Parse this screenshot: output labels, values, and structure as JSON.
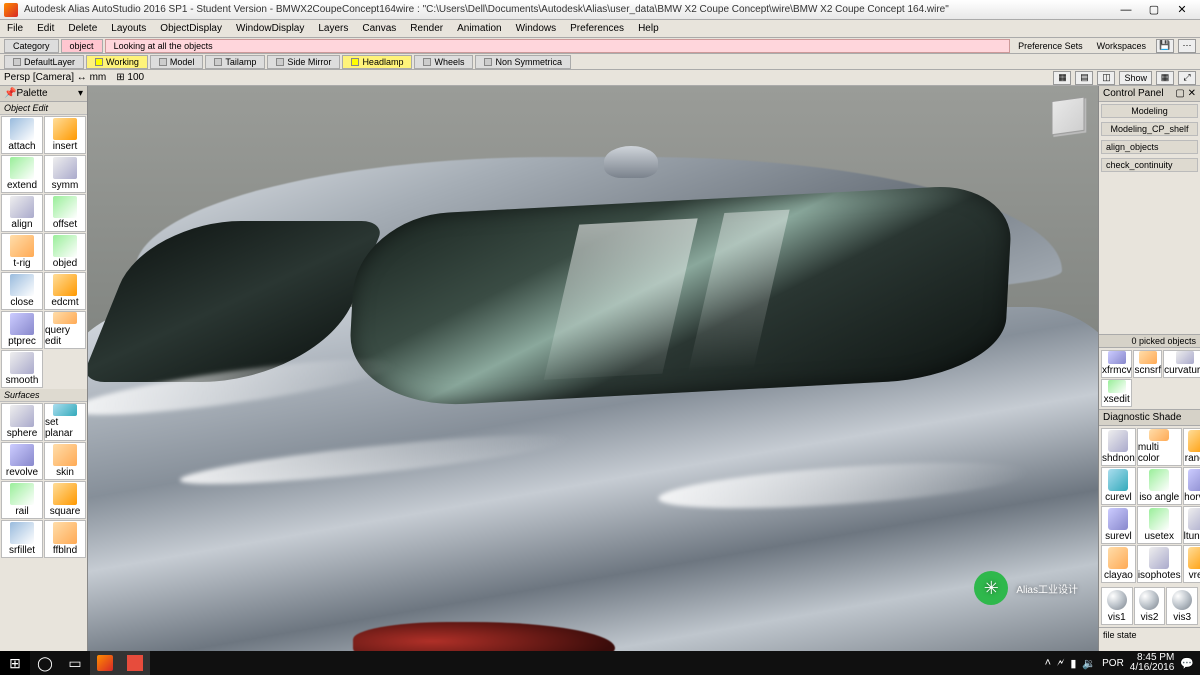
{
  "title": "Autodesk Alias AutoStudio 2016 SP1 - Student Version   - BMWX2CoupeConcept164wire : \"C:\\Users\\Dell\\Documents\\Autodesk\\Alias\\user_data\\BMW X2 Coupe Concept\\wire\\BMW X2 Coupe Concept 164.wire\"",
  "menu": [
    "File",
    "Edit",
    "Delete",
    "Layouts",
    "ObjectDisplay",
    "WindowDisplay",
    "Layers",
    "Canvas",
    "Render",
    "Animation",
    "Windows",
    "Preferences",
    "Help"
  ],
  "shelf1": {
    "category": "Category",
    "object": "object",
    "message": "Looking at all the objects",
    "prefsets": "Preference Sets",
    "workspaces": "Workspaces"
  },
  "shelf2": {
    "items": [
      {
        "label": "DefaultLayer",
        "cls": ""
      },
      {
        "label": "Working",
        "cls": "yellow"
      },
      {
        "label": "Model",
        "cls": ""
      },
      {
        "label": "Tailamp",
        "cls": ""
      },
      {
        "label": "Side Mirror",
        "cls": ""
      },
      {
        "label": "Headlamp",
        "cls": "yellow"
      },
      {
        "label": "Wheels",
        "cls": ""
      },
      {
        "label": "Non Symmetrica",
        "cls": ""
      }
    ]
  },
  "prompt": {
    "cam": "Persp [Camera]  ↔ mm",
    "tol": "⊞ 100",
    "show": "Show"
  },
  "palette": {
    "title": "Palette",
    "sec1": "Object Edit",
    "tools1": [
      {
        "l": "attach",
        "g": "g1"
      },
      {
        "l": "insert",
        "g": "g2"
      },
      {
        "l": "extend",
        "g": "g3"
      },
      {
        "l": "symm",
        "g": "g4"
      },
      {
        "l": "align",
        "g": "g4"
      },
      {
        "l": "offset",
        "g": "g3"
      },
      {
        "l": "t-rig",
        "g": "g6"
      },
      {
        "l": "objed",
        "g": "g3"
      },
      {
        "l": "close",
        "g": "g1"
      },
      {
        "l": "edcmt",
        "g": "g2"
      },
      {
        "l": "ptprec",
        "g": "g5"
      },
      {
        "l": "query edit",
        "g": "g6"
      },
      {
        "l": "smooth",
        "g": "g4"
      },
      {
        "l": "",
        "g": ""
      }
    ],
    "sec2": "Surfaces",
    "tools2": [
      {
        "l": "sphere",
        "g": "g4"
      },
      {
        "l": "set planar",
        "g": "g7"
      },
      {
        "l": "revolve",
        "g": "g5"
      },
      {
        "l": "skin",
        "g": "g6"
      },
      {
        "l": "rail",
        "g": "g3"
      },
      {
        "l": "square",
        "g": "g2"
      },
      {
        "l": "srfillet",
        "g": "g1"
      },
      {
        "l": "ffblnd",
        "g": "g6"
      }
    ]
  },
  "right": {
    "control_panel": "Control Panel",
    "modeling": "Modeling",
    "modeling_shelf": "Modeling_CP_shelf",
    "btn1": "align_objects",
    "btn2": "check_continuity",
    "picked": "0 picked objects",
    "picked_tools": [
      {
        "l": "xfrmcv",
        "g": "g5"
      },
      {
        "l": "scnsrf",
        "g": "g6"
      },
      {
        "l": "curvature",
        "g": "g4"
      },
      {
        "l": "xsedit",
        "g": "g3"
      },
      {
        "l": "",
        "g": ""
      },
      {
        "l": "",
        "g": ""
      }
    ],
    "diag_title": "Diagnostic Shade",
    "diag_tools": [
      {
        "l": "shdnon",
        "g": "g4"
      },
      {
        "l": "multi color",
        "g": "g6"
      },
      {
        "l": "rancol",
        "g": "g2"
      },
      {
        "l": "curevl",
        "g": "g7"
      },
      {
        "l": "iso angle",
        "g": "g3"
      },
      {
        "l": "horver",
        "g": "g5"
      },
      {
        "l": "surevl",
        "g": "g5"
      },
      {
        "l": "usetex",
        "g": "g3"
      },
      {
        "l": "ltunnel",
        "g": "g4"
      },
      {
        "l": "clayao",
        "g": "g6"
      },
      {
        "l": "isophotes",
        "g": "g4"
      },
      {
        "l": "vred",
        "g": "g2"
      }
    ],
    "vis": [
      "vis1",
      "vis2",
      "vis3"
    ],
    "file_state": "file state"
  },
  "watermark": "Alias工业设计",
  "taskbar": {
    "lang": "POR",
    "time": "8:45 PM",
    "date": "4/16/2016"
  }
}
